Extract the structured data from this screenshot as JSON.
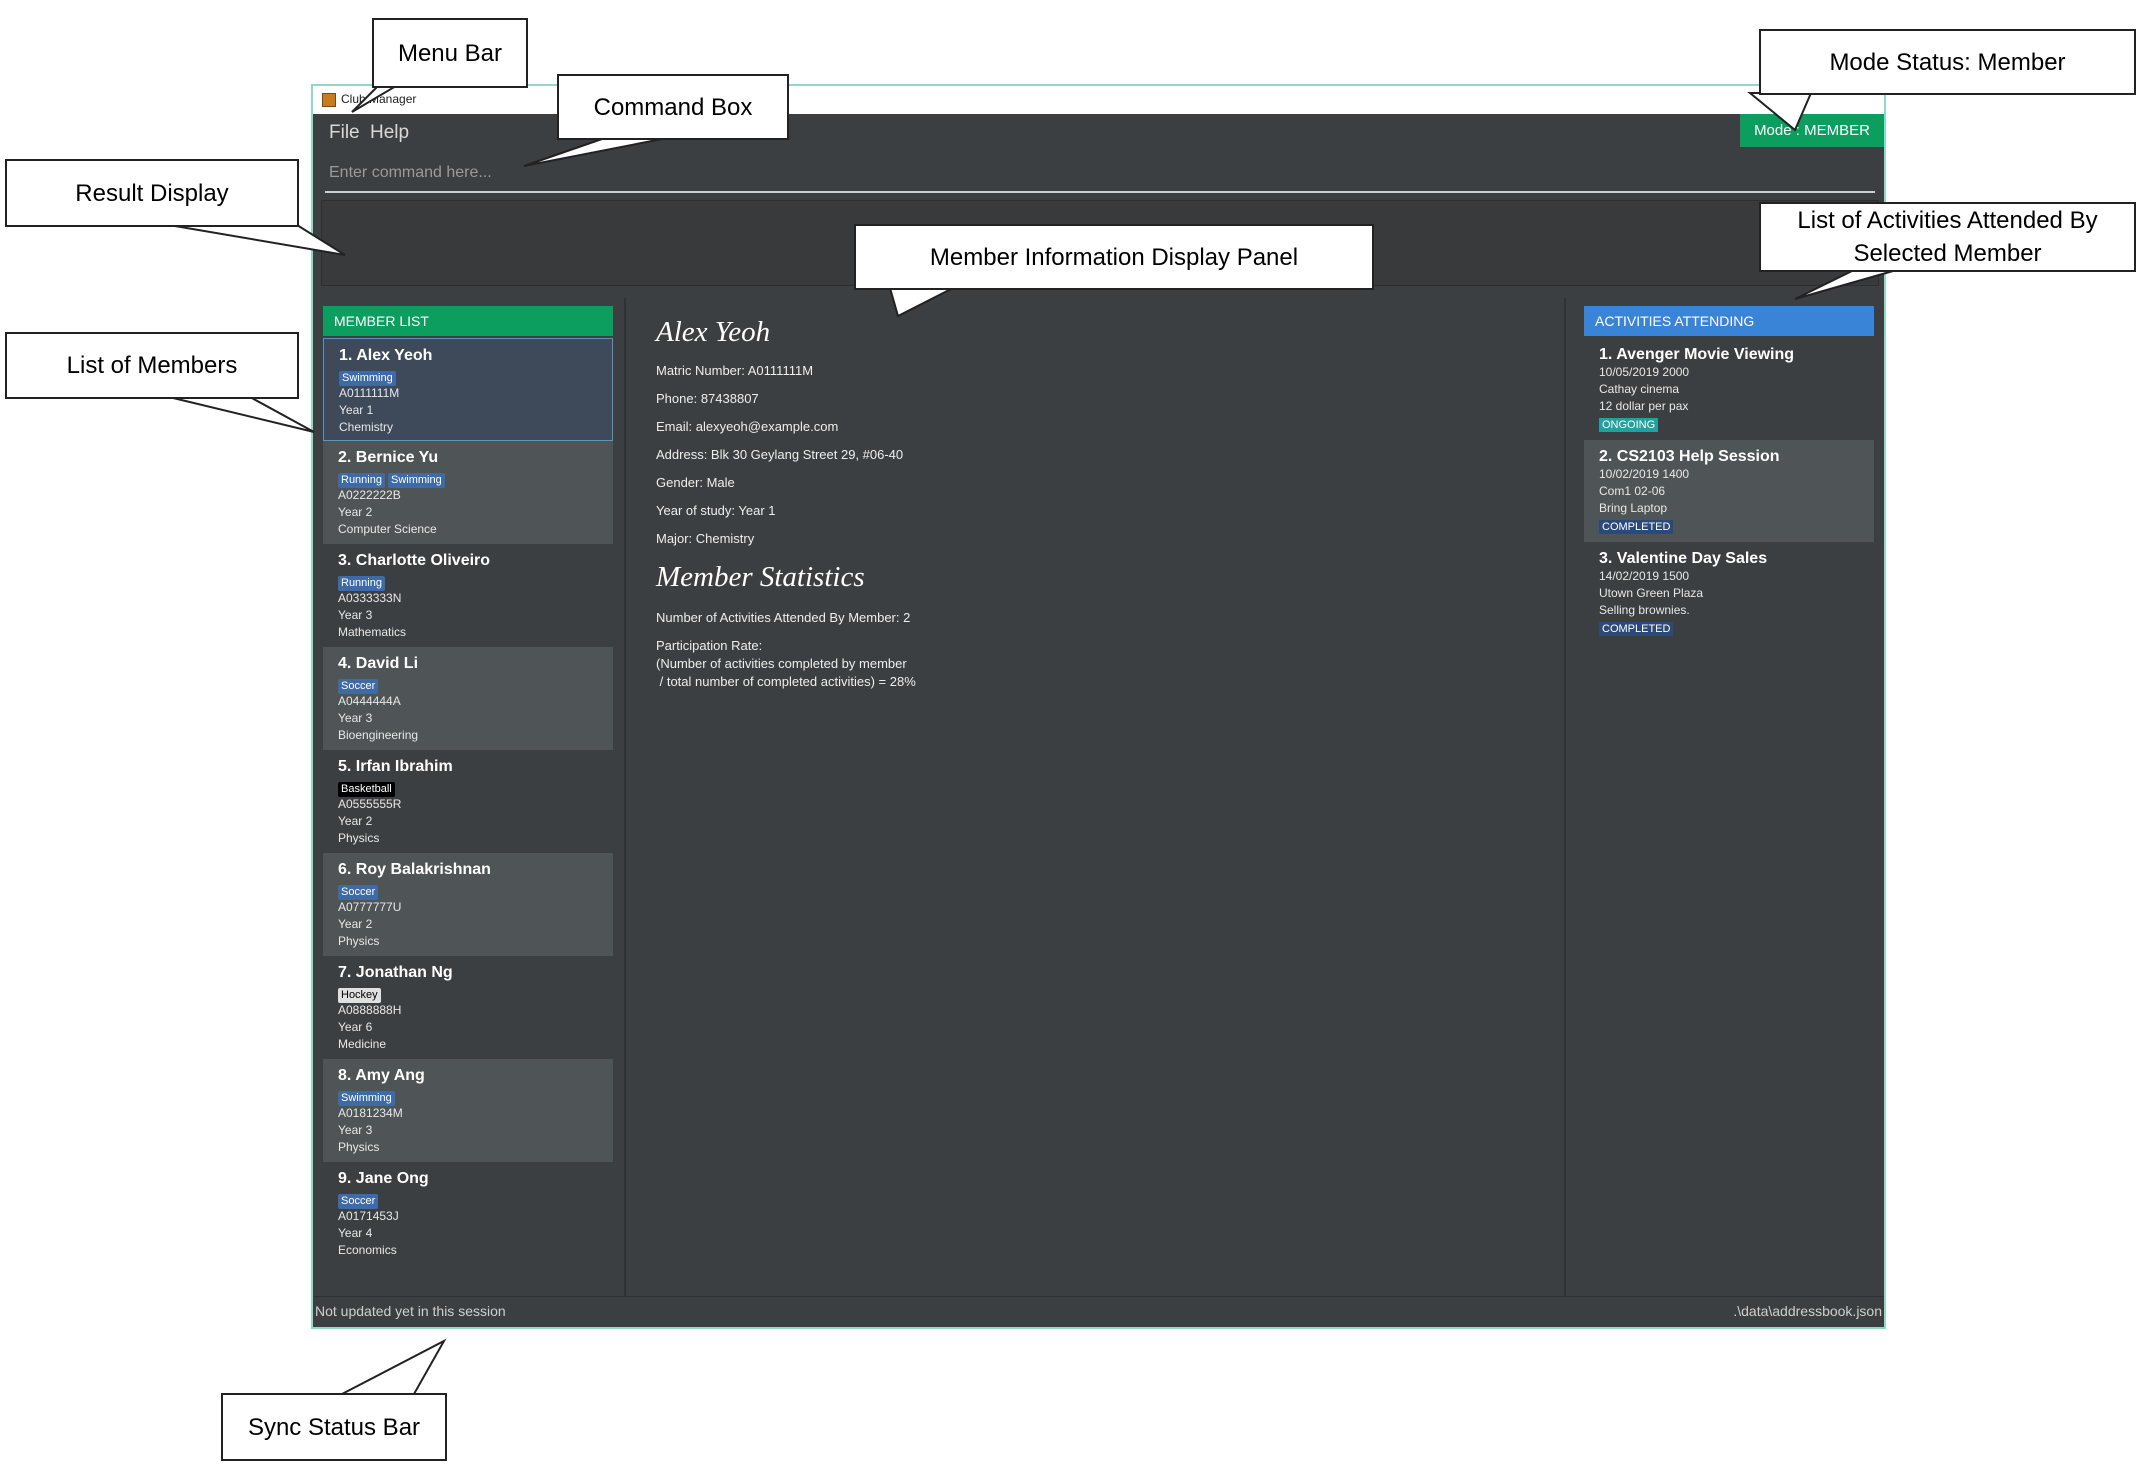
{
  "window": {
    "title": "Club Manager",
    "minimize": "–"
  },
  "menu": {
    "file": "File",
    "help": "Help",
    "mode": "Mode : MEMBER"
  },
  "command": {
    "placeholder": "Enter command here..."
  },
  "members": {
    "header": "MEMBER LIST",
    "items": [
      {
        "name": "1.  Alex Yeoh",
        "tags": [
          "Swimming"
        ],
        "matric": "A0111111M",
        "year": "Year 1",
        "major": "Chemistry"
      },
      {
        "name": "2.  Bernice Yu",
        "tags": [
          "Running",
          "Swimming"
        ],
        "matric": "A0222222B",
        "year": "Year 2",
        "major": "Computer Science"
      },
      {
        "name": "3.  Charlotte Oliveiro",
        "tags": [
          "Running"
        ],
        "matric": "A0333333N",
        "year": "Year 3",
        "major": "Mathematics"
      },
      {
        "name": "4.  David Li",
        "tags": [
          "Soccer"
        ],
        "matric": "A0444444A",
        "year": "Year 3",
        "major": "Bioengineering"
      },
      {
        "name": "5.  Irfan Ibrahim",
        "tags": [
          "Basketball"
        ],
        "matric": "A0555555R",
        "year": "Year 2",
        "major": "Physics"
      },
      {
        "name": "6.  Roy Balakrishnan",
        "tags": [
          "Soccer"
        ],
        "matric": "A0777777U",
        "year": "Year 2",
        "major": "Physics"
      },
      {
        "name": "7.  Jonathan Ng",
        "tags": [
          "Hockey"
        ],
        "matric": "A0888888H",
        "year": "Year 6",
        "major": "Medicine"
      },
      {
        "name": "8.  Amy Ang",
        "tags": [
          "Swimming"
        ],
        "matric": "A0181234M",
        "year": "Year 3",
        "major": "Physics"
      },
      {
        "name": "9.  Jane Ong",
        "tags": [
          "Soccer"
        ],
        "matric": "A0171453J",
        "year": "Year 4",
        "major": "Economics"
      }
    ]
  },
  "info": {
    "name": "Alex Yeoh",
    "matric": "Matric Number: A0111111M",
    "phone": "Phone: 87438807",
    "email": "Email: alexyeoh@example.com",
    "address": "Address: Blk 30 Geylang Street 29, #06-40",
    "gender": "Gender: Male",
    "year": "Year of study: Year 1",
    "major": "Major: Chemistry",
    "stats_title": "Member Statistics",
    "attended": "Number of Activities Attended By Member: 2",
    "rate_label": "Participation Rate:",
    "rate_line1": "(Number of activities completed by member",
    "rate_line2": " / total number of completed activities) = 28%"
  },
  "activities": {
    "header": "ACTIVITIES ATTENDING",
    "items": [
      {
        "name": "1.  Avenger Movie Viewing",
        "datetime": "10/05/2019 2000",
        "location": "Cathay cinema",
        "note": "12 dollar per pax",
        "status": "ONGOING"
      },
      {
        "name": "2.  CS2103 Help Session",
        "datetime": "10/02/2019 1400",
        "location": "Com1 02-06",
        "note": "Bring Laptop",
        "status": "COMPLETED"
      },
      {
        "name": "3.  Valentine Day Sales",
        "datetime": "14/02/2019 1500",
        "location": "Utown Green Plaza",
        "note": "Selling brownies.",
        "status": "COMPLETED"
      }
    ]
  },
  "statusbar": {
    "left": "Not updated yet in this session",
    "right": ".\\data\\addressbook.json"
  },
  "callouts": {
    "menu_bar": "Menu Bar",
    "command_box": "Command Box",
    "mode_status": "Mode Status: Member",
    "result_display": "Result Display",
    "info_panel": "Member Information Display Panel",
    "activities": "List of Activities Attended By Selected Member",
    "members": "List of Members",
    "sync": "Sync Status Bar"
  }
}
